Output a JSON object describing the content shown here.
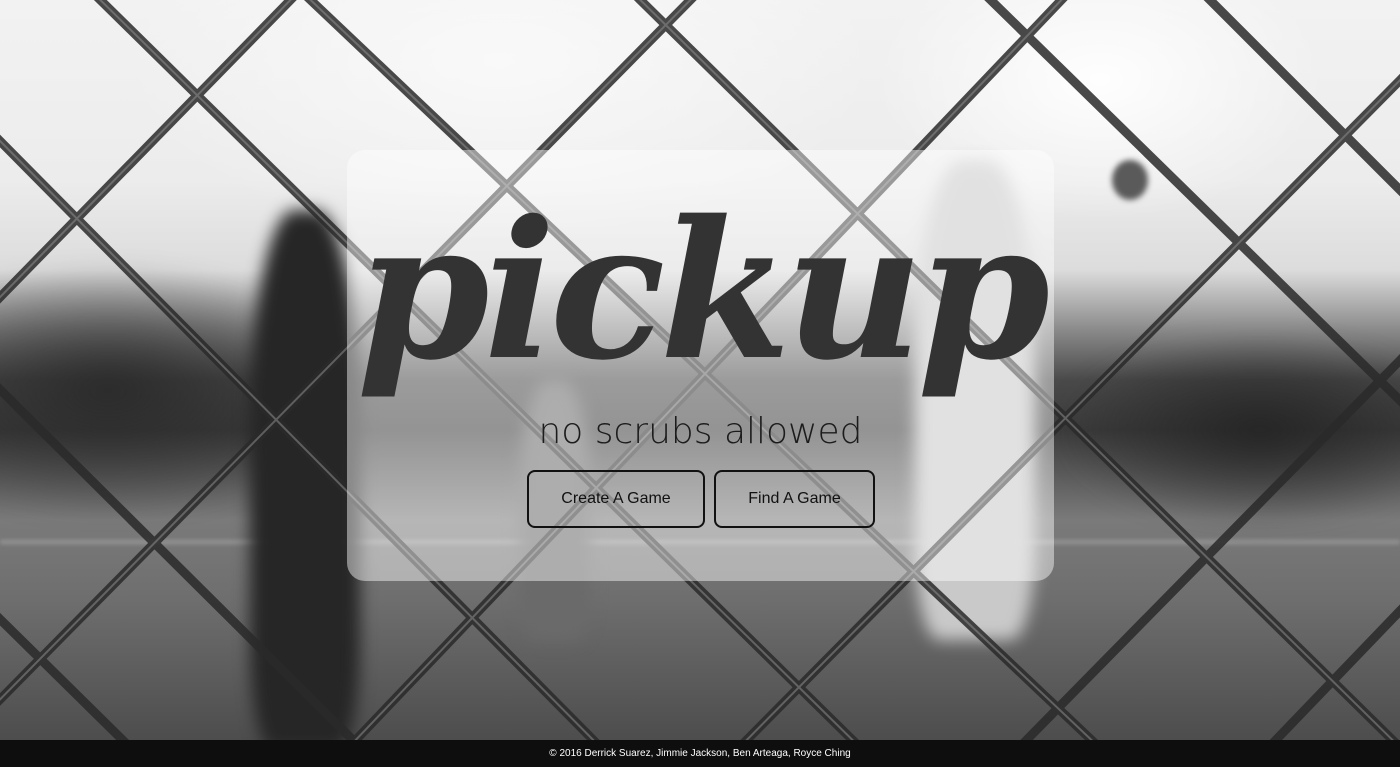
{
  "app": {
    "title": "pickup",
    "tagline": "no scrubs allowed"
  },
  "actions": {
    "create_label": "Create A Game",
    "find_label": "Find A Game"
  },
  "footer": {
    "copyright": "© 2016 Derrick Suarez, Jimmie Jackson, Ben Arteaga, Royce Ching"
  },
  "colors": {
    "card": "#ffffff",
    "title_text": "#333333",
    "button_border": "#111111",
    "footer_bg": "#0e0e0e",
    "footer_text": "#ffffff"
  },
  "background": {
    "description_icon": "chain-link-fence-photo"
  }
}
